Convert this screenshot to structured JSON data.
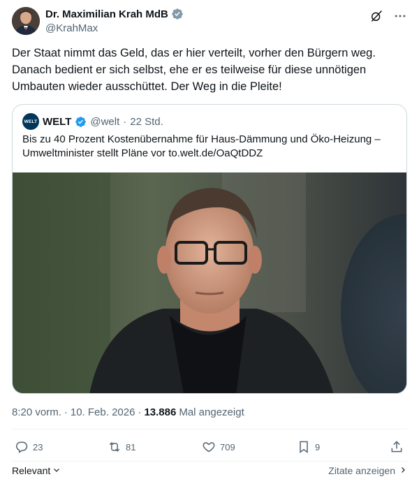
{
  "author": {
    "display_name": "Dr. Maximilian Krah MdB",
    "handle": "@KrahMax",
    "verified_color": "#829aab",
    "avatar": "avatar"
  },
  "tweet": {
    "text": "Der Staat nimmt das Geld, das er hier verteilt, vorher den Bürgern weg. Danach bedient er sich selbst, ehe er es teilweise für diese unnötigen Umbauten wieder ausschüttet. Der Weg in die Pleite!"
  },
  "quote": {
    "logo_text": "WELT",
    "name": "WELT",
    "handle": "@welt",
    "separator": "·",
    "time": "22 Std.",
    "verified_color": "#1d9bf0",
    "text": "Bis zu 40 Prozent Kostenübernahme für Haus-Dämmung und Öko-Heizung – Umweltminister stellt Pläne vor to.welt.de/OaQtDDZ",
    "image": "photo"
  },
  "meta": {
    "time": "8:20 vorm.",
    "sep1": "·",
    "date": "10. Feb. 2026",
    "sep2": "·",
    "views": "13.886",
    "views_label": "Mal angezeigt"
  },
  "actions": {
    "replies": "23",
    "reposts": "81",
    "likes": "709",
    "bookmarks": "9"
  },
  "footer": {
    "relevant": "Relevant",
    "quotes_link": "Zitate anzeigen"
  },
  "colors": {
    "text": "#0f1419",
    "muted": "#536471",
    "border": "#cfd9de"
  }
}
